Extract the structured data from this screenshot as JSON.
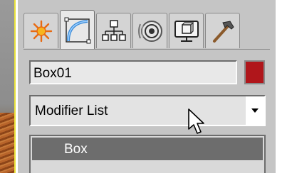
{
  "tabs": [
    {
      "name": "create-icon",
      "active": false
    },
    {
      "name": "modify-icon",
      "active": true
    },
    {
      "name": "hierarchy-icon",
      "active": false
    },
    {
      "name": "motion-icon",
      "active": false
    },
    {
      "name": "display-icon",
      "active": false
    },
    {
      "name": "utilities-icon",
      "active": false
    }
  ],
  "object": {
    "name_value": "Box01",
    "color": "#b0161b"
  },
  "modifier_list": {
    "label": "Modifier List"
  },
  "stack": {
    "items": [
      {
        "label": "Box",
        "selected": true
      }
    ]
  },
  "colors": {
    "panel_bg": "#c5c5c5",
    "accent_yellow": "#e9e23b",
    "selected_row": "#6d6d6d"
  }
}
